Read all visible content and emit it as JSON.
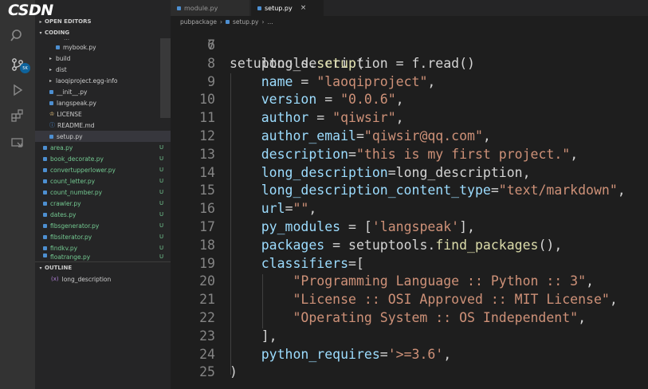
{
  "logo_text": "CSDN",
  "activity": {
    "scm_badge": "5K"
  },
  "sidebar": {
    "open_editors_label": "OPEN EDITORS",
    "coding_label": "CODING",
    "outline_label": "OUTLINE",
    "partial_item": "...",
    "items": [
      {
        "label": "mybook.py",
        "kind": "py",
        "status": ""
      },
      {
        "label": "build",
        "kind": "folder",
        "status": ""
      },
      {
        "label": "dist",
        "kind": "folder",
        "status": ""
      },
      {
        "label": "laoqiproject.egg-info",
        "kind": "folder",
        "status": ""
      },
      {
        "label": "__init__.py",
        "kind": "py",
        "status": ""
      },
      {
        "label": "langspeak.py",
        "kind": "py",
        "status": ""
      },
      {
        "label": "LICENSE",
        "kind": "license",
        "status": ""
      },
      {
        "label": "README.md",
        "kind": "info",
        "status": ""
      },
      {
        "label": "setup.py",
        "kind": "py",
        "status": ""
      },
      {
        "label": "area.py",
        "kind": "py",
        "status": "U"
      },
      {
        "label": "book_decorate.py",
        "kind": "py",
        "status": "U"
      },
      {
        "label": "convertupperlower.py",
        "kind": "py",
        "status": "U"
      },
      {
        "label": "count_letter.py",
        "kind": "py",
        "status": "U"
      },
      {
        "label": "count_number.py",
        "kind": "py",
        "status": "U"
      },
      {
        "label": "crawler.py",
        "kind": "py",
        "status": "U"
      },
      {
        "label": "dates.py",
        "kind": "py",
        "status": "U"
      },
      {
        "label": "fibsgenerator.py",
        "kind": "py",
        "status": "U"
      },
      {
        "label": "fibsiterator.py",
        "kind": "py",
        "status": "U"
      },
      {
        "label": "findkv.py",
        "kind": "py",
        "status": "U"
      },
      {
        "label": "floatrange.py",
        "kind": "py",
        "status": "U"
      }
    ],
    "outline_item": "long_description"
  },
  "tabs": [
    {
      "label": "module.py"
    },
    {
      "label": "setup.py",
      "close": "×"
    }
  ],
  "breadcrumb": [
    "pubpackage",
    "setup.py",
    "..."
  ],
  "editor": {
    "partial_line_number": "6",
    "partial_line_text": "    long_description = f.read()",
    "lines": [
      {
        "n": "7",
        "code": ""
      },
      {
        "n": "8",
        "code": "setuptools.setup("
      },
      {
        "n": "9",
        "code": "    name = \"laoqiproject\","
      },
      {
        "n": "10",
        "code": "    version = \"0.0.6\","
      },
      {
        "n": "11",
        "code": "    author = \"qiwsir\","
      },
      {
        "n": "12",
        "code": "    author_email=\"qiwsir@qq.com\","
      },
      {
        "n": "13",
        "code": "    description=\"this is my first project.\","
      },
      {
        "n": "14",
        "code": "    long_description=long_description,"
      },
      {
        "n": "15",
        "code": "    long_description_content_type=\"text/markdown\","
      },
      {
        "n": "16",
        "code": "    url=\"\","
      },
      {
        "n": "17",
        "code": "    py_modules = ['langspeak'],"
      },
      {
        "n": "18",
        "code": "    packages = setuptools.find_packages(),"
      },
      {
        "n": "19",
        "code": "    classifiers=["
      },
      {
        "n": "20",
        "code": "        \"Programming Language :: Python :: 3\","
      },
      {
        "n": "21",
        "code": "        \"License :: OSI Approved :: MIT License\","
      },
      {
        "n": "22",
        "code": "        \"Operating System :: OS Independent\","
      },
      {
        "n": "23",
        "code": "    ],"
      },
      {
        "n": "24",
        "code": "    python_requires='>=3.6',"
      },
      {
        "n": "25",
        "code": ")"
      }
    ]
  }
}
